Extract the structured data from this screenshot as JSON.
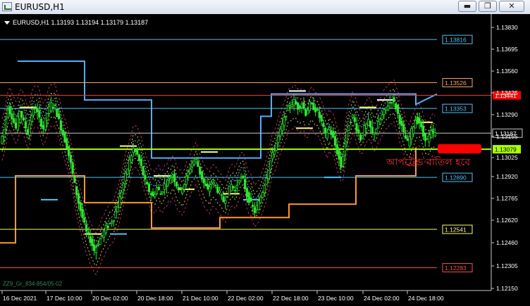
{
  "window": {
    "title": "EURUSD,H1",
    "min_glyph": "▬",
    "max_glyph": "❐",
    "close_glyph": "✕"
  },
  "chart_header": {
    "text": "EURUSD,H1  1.13193 1.13194 1.13179 1.13187"
  },
  "indicator_label": "ZZ9_Gr_834-854/05-02",
  "annotation": "আপট্রেন্ড বাতিল হবে",
  "colors": {
    "background": "#000000",
    "grid": "#2b2b2b",
    "candle": "#2ee62e",
    "annotation": "#ff2a2a"
  },
  "price_axis": {
    "ticks": [
      "1.13830",
      "1.13695",
      "1.13560",
      "1.13425",
      "1.13290",
      "1.13155",
      "1.13025",
      "1.12920",
      "1.12765",
      "1.12620",
      "1.12460",
      "1.12305",
      "1.12150"
    ]
  },
  "time_axis": {
    "ticks": [
      "16 Dec 2021",
      "17 Dec 10:00",
      "20 Dec 02:00",
      "20 Dec 18:00",
      "21 Dec 10:00",
      "22 Dec 02:00",
      "22 Dec 18:00",
      "23 Dec 10:00",
      "24 Dec 02:00",
      "24 Dec 18:00"
    ]
  },
  "level_labels": [
    {
      "text": "1.13816",
      "color": "#4fc3f7"
    },
    {
      "text": "1.13526",
      "color": "#ffa64d"
    },
    {
      "text": "1.13441",
      "color": "#ffffff",
      "bg": "#ff0000"
    },
    {
      "text": "1.13353",
      "color": "#4fc3f7"
    },
    {
      "text": "1.13187",
      "color": "#ffffff"
    },
    {
      "text": "1.13079",
      "color": "#000000",
      "bg": "#aaff00"
    },
    {
      "text": "1.12890",
      "color": "#4fc3f7"
    },
    {
      "text": "1.12541",
      "color": "#ffff66"
    },
    {
      "text": "1.12283",
      "color": "#ff4d4d"
    }
  ],
  "chart_data": {
    "type": "candlestick",
    "symbol": "EURUSD",
    "timeframe": "H1",
    "last_bar": {
      "open": 1.13193,
      "high": 1.13194,
      "low": 1.13179,
      "close": 1.13187
    },
    "ylim": [
      1.1213,
      1.1393
    ],
    "grid": false,
    "horizontal_levels": [
      1.13816,
      1.13526,
      1.13441,
      1.13353,
      1.13187,
      1.13079,
      1.1289,
      1.12541,
      1.12283
    ],
    "close_path": [
      1.1312,
      1.1321,
      1.1336,
      1.133,
      1.1322,
      1.1334,
      1.1326,
      1.1319,
      1.1331,
      1.1336,
      1.1328,
      1.1322,
      1.1332,
      1.1338,
      1.1336,
      1.1327,
      1.1318,
      1.131,
      1.1298,
      1.1284,
      1.1272,
      1.1262,
      1.1252,
      1.1247,
      1.124,
      1.1245,
      1.125,
      1.1255,
      1.1258,
      1.1262,
      1.127,
      1.128,
      1.129,
      1.13,
      1.1308,
      1.1304,
      1.1296,
      1.1286,
      1.128,
      1.1276,
      1.1282,
      1.1278,
      1.1284,
      1.1287,
      1.1291,
      1.1284,
      1.128,
      1.1285,
      1.1292,
      1.1299,
      1.1301,
      1.1292,
      1.1285,
      1.128,
      1.1286,
      1.1283,
      1.1278,
      1.1273,
      1.1278,
      1.1284,
      1.128,
      1.1289,
      1.1287,
      1.1277,
      1.1271,
      1.1266,
      1.1272,
      1.128,
      1.129,
      1.13,
      1.1308,
      1.1316,
      1.1324,
      1.1332,
      1.1338,
      1.134,
      1.1336,
      1.1339,
      1.1332,
      1.1338,
      1.1336,
      1.1333,
      1.1326,
      1.1317,
      1.1322,
      1.1315,
      1.1306,
      1.1296,
      1.1312,
      1.1325,
      1.133,
      1.1322,
      1.1315,
      1.1322,
      1.1326,
      1.1318,
      1.1322,
      1.1328,
      1.1333,
      1.1338,
      1.1341,
      1.1336,
      1.1327,
      1.1318,
      1.1312,
      1.132,
      1.1328,
      1.1326,
      1.1317,
      1.1314,
      1.1319,
      1.1318
    ]
  }
}
